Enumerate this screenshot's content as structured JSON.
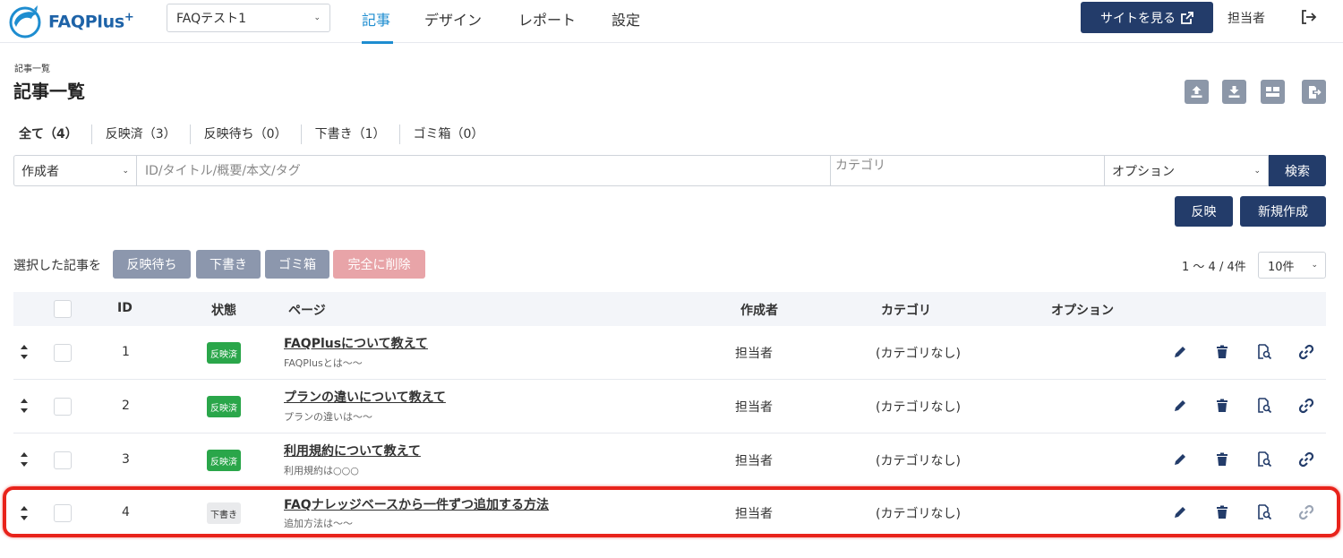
{
  "header": {
    "logo_text": "FAQPlus",
    "logo_plus": "+",
    "site_selector": "FAQテスト1",
    "tabs": [
      {
        "label": "記事"
      },
      {
        "label": "デザイン"
      },
      {
        "label": "レポート"
      },
      {
        "label": "設定"
      }
    ],
    "view_site_label": "サイトを見る",
    "user_name": "担当者"
  },
  "page": {
    "breadcrumb": "記事一覧",
    "title": "記事一覧"
  },
  "status_tabs": [
    {
      "label": "全て（4）"
    },
    {
      "label": "反映済（3）"
    },
    {
      "label": "反映待ち（0）"
    },
    {
      "label": "下書き（1）"
    },
    {
      "label": "ゴミ箱（0）"
    }
  ],
  "search": {
    "author_label": "作成者",
    "keyword_placeholder": "ID/タイトル/概要/本文/タグ",
    "category_placeholder": "カテゴリ",
    "option_label": "オプション",
    "search_label": "検索"
  },
  "actions": {
    "publish_label": "反映",
    "new_label": "新規作成"
  },
  "bulk": {
    "label": "選択した記事を",
    "pending_label": "反映待ち",
    "draft_label": "下書き",
    "trash_label": "ゴミ箱",
    "delete_label": "完全に削除",
    "count_text": "1 ～ 4 / 4件",
    "per_page": "10件"
  },
  "table": {
    "columns": {
      "id": "ID",
      "status": "状態",
      "page": "ページ",
      "author": "作成者",
      "category": "カテゴリ",
      "option": "オプション"
    },
    "rows": [
      {
        "id": "1",
        "status": "反映済",
        "title": "FAQPlusについて教えて",
        "summary": "FAQPlusとは～～",
        "author": "担当者",
        "category": "(カテゴリなし)"
      },
      {
        "id": "2",
        "status": "反映済",
        "title": "プランの違いについて教えて",
        "summary": "プランの違いは～～",
        "author": "担当者",
        "category": "(カテゴリなし)"
      },
      {
        "id": "3",
        "status": "反映済",
        "title": "利用規約について教えて",
        "summary": "利用規約は○○○",
        "author": "担当者",
        "category": "(カテゴリなし)"
      },
      {
        "id": "4",
        "status": "下書き",
        "title": "FAQナレッジベースから一件ずつ追加する方法",
        "summary": "追加方法は～～",
        "author": "担当者",
        "category": "(カテゴリなし)"
      }
    ]
  },
  "colors": {
    "navy": "#233c6a",
    "accent": "#1e8dd0",
    "published": "#2aa64a",
    "highlight": "#e8231b"
  }
}
